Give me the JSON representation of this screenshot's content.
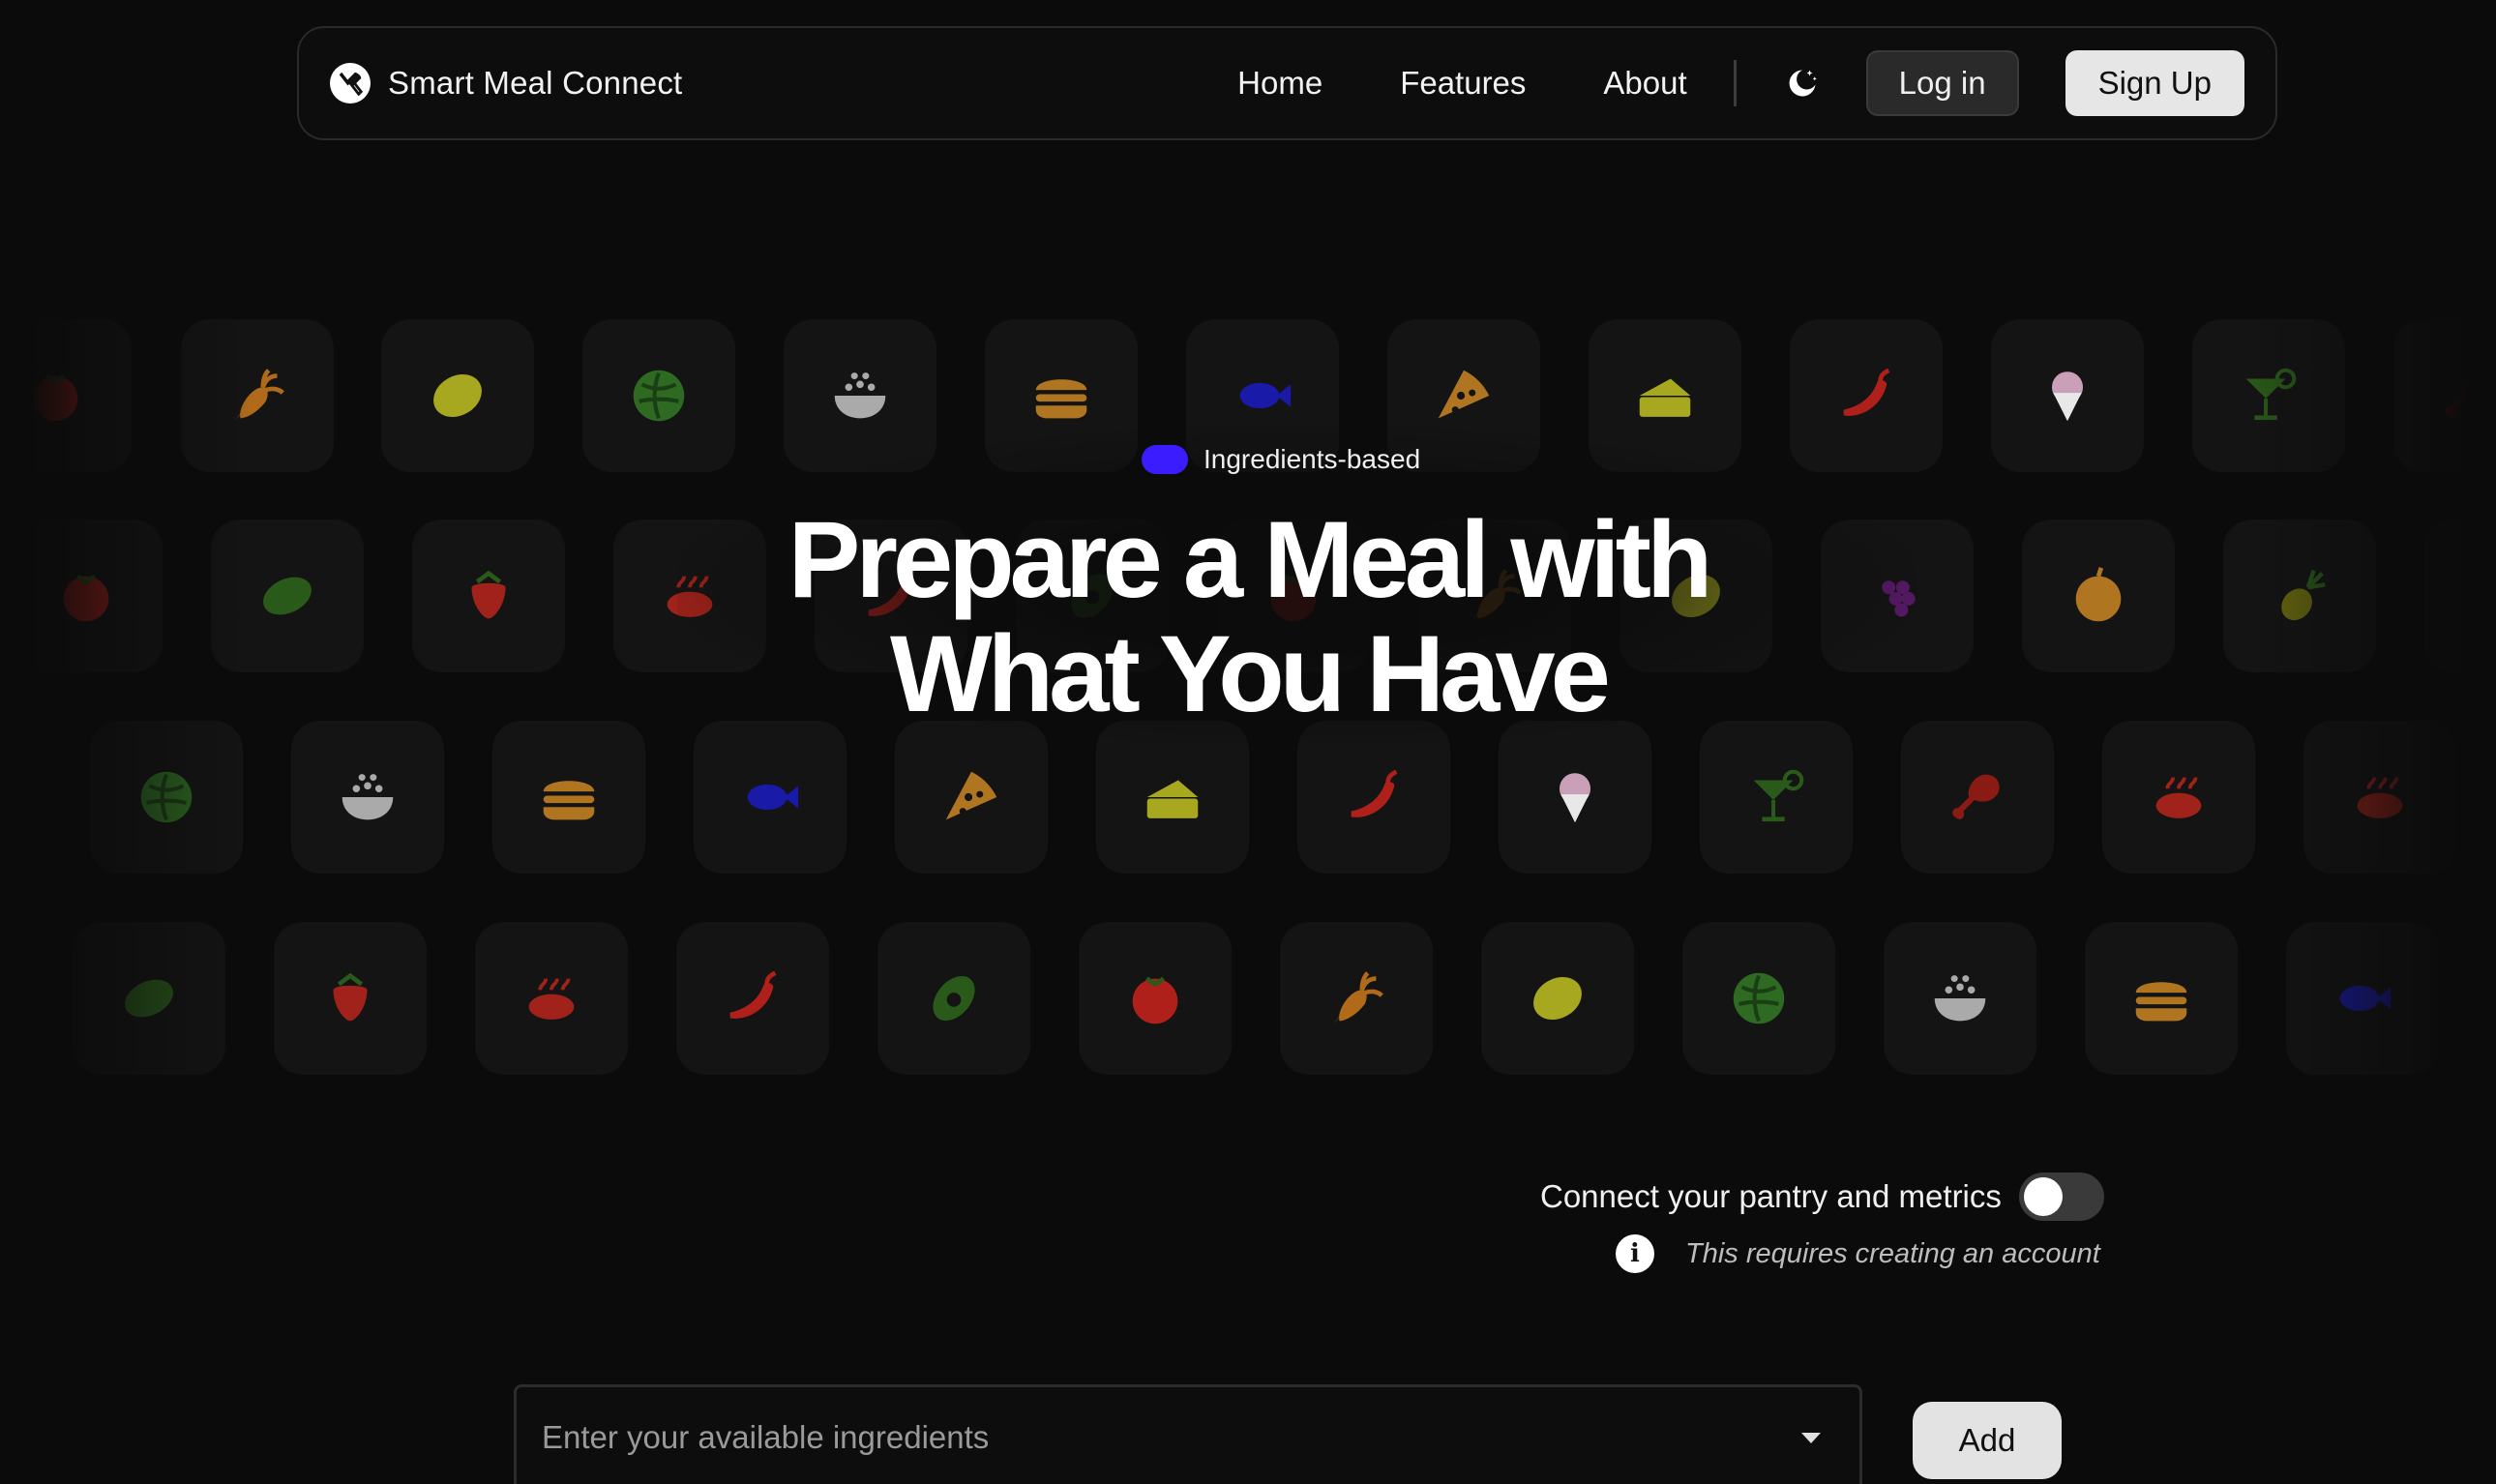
{
  "nav": {
    "brand": "Smart Meal Connect",
    "links": [
      "Home",
      "Features",
      "About"
    ],
    "login_label": "Log in",
    "signup_label": "Sign Up",
    "theme_icon": "moon-stars-icon"
  },
  "hero": {
    "badge": "Ingredients-based",
    "badge_color": "#3b1cff",
    "title_line1": "Prepare a Meal with",
    "title_line2": "What You Have"
  },
  "pantry": {
    "label": "Connect your pantry and metrics",
    "toggle_on": false,
    "note": "This requires creating an account"
  },
  "ingredients": {
    "placeholder": "Enter your available ingredients",
    "add_label": "Add"
  },
  "food_icons": [
    "carrot",
    "lemon",
    "cabbage",
    "rice-bowl",
    "burger",
    "fish",
    "pizza",
    "cake",
    "chili",
    "ice-cream",
    "cocktail",
    "meat-leg",
    "watermelon",
    "strawberry",
    "roast-chicken",
    "avocado",
    "tomato",
    "grapes",
    "peach",
    "pineapple"
  ]
}
